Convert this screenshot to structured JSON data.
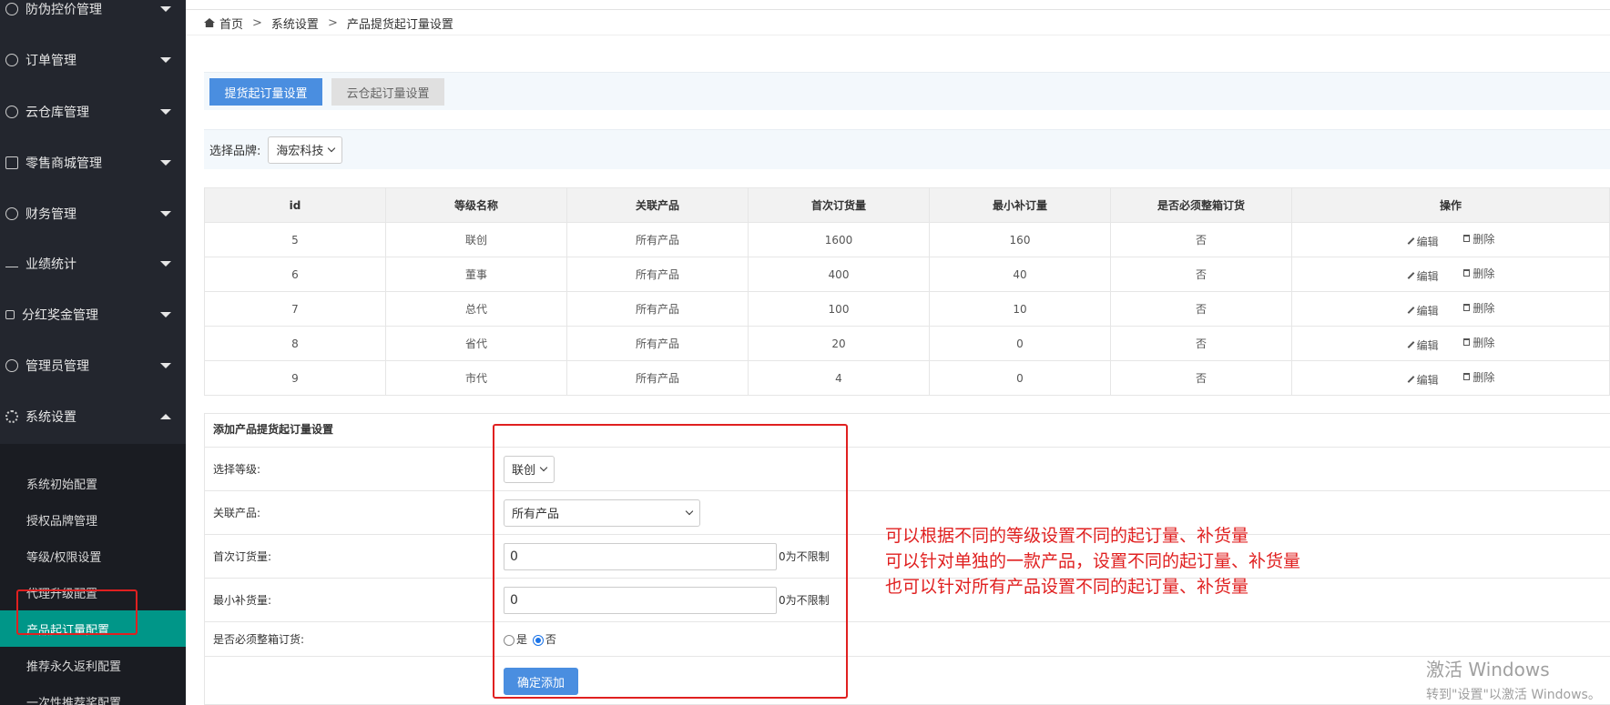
{
  "sidebar": {
    "items": [
      {
        "label": "防伪控价管理",
        "icon": "shield-icon"
      },
      {
        "label": "订单管理",
        "icon": "order-icon"
      },
      {
        "label": "云仓库管理",
        "icon": "cloud-icon"
      },
      {
        "label": "零售商城管理",
        "icon": "box-icon"
      },
      {
        "label": "财务管理",
        "icon": "yen-icon"
      },
      {
        "label": "业绩统计",
        "icon": "pulse-icon"
      },
      {
        "label": "分红奖金管理",
        "icon": "grid-icon"
      },
      {
        "label": "管理员管理",
        "icon": "user-icon"
      },
      {
        "label": "系统设置",
        "icon": "gear-icon"
      }
    ],
    "submenu": [
      {
        "label": "系统初始配置"
      },
      {
        "label": "授权品牌管理"
      },
      {
        "label": "等级/权限设置"
      },
      {
        "label": "代理升级配置"
      },
      {
        "label": "产品起订量配置",
        "active": true
      },
      {
        "label": "推荐永久返利配置"
      },
      {
        "label": "一次性推荐奖配置"
      }
    ]
  },
  "breadcrumb": {
    "home": "首页",
    "level1": "系统设置",
    "level2": "产品提货起订量设置",
    "sep": ">"
  },
  "tabs": {
    "active": "提货起订量设置",
    "inactive": "云仓起订量设置"
  },
  "brand": {
    "label": "选择品牌:",
    "value": "海宏科技"
  },
  "table": {
    "headers": [
      "id",
      "等级名称",
      "关联产品",
      "首次订货量",
      "最小补订量",
      "是否必须整箱订货",
      "操作"
    ],
    "rows": [
      [
        "5",
        "联创",
        "所有产品",
        "1600",
        "160",
        "否"
      ],
      [
        "6",
        "董事",
        "所有产品",
        "400",
        "40",
        "否"
      ],
      [
        "7",
        "总代",
        "所有产品",
        "100",
        "10",
        "否"
      ],
      [
        "8",
        "省代",
        "所有产品",
        "20",
        "0",
        "否"
      ],
      [
        "9",
        "市代",
        "所有产品",
        "4",
        "0",
        "否"
      ]
    ],
    "edit_label": "编辑",
    "delete_label": "删除"
  },
  "form": {
    "title": "添加产品提货起订量设置",
    "level_label": "选择等级:",
    "level_value": "联创",
    "product_label": "关联产品:",
    "product_value": "所有产品",
    "first_label": "首次订货量:",
    "first_value": "0",
    "first_hint": "0为不限制",
    "min_label": "最小补货量:",
    "min_value": "0",
    "min_hint": "0为不限制",
    "box_label": "是否必须整箱订货:",
    "yes": "是",
    "no": "否",
    "submit": "确定添加"
  },
  "annotation": {
    "line1": "可以根据不同的等级设置不同的起订量、补货量",
    "line2": "可以针对单独的一款产品，设置不同的起订量、补货量",
    "line3": "也可以针对所有产品设置不同的起订量、补货量"
  },
  "watermark": {
    "line1": "激活 Windows",
    "line2": "转到\"设置\"以激活 Windows。"
  }
}
